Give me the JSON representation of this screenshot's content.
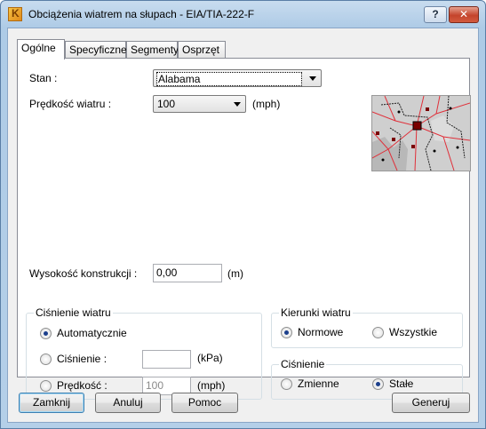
{
  "window": {
    "title": "Obciążenia wiatrem na słupach - EIA/TIA-222-F",
    "help_label": "?",
    "close_label": "✕"
  },
  "tabs": [
    {
      "label": "Ogólne",
      "active": true
    },
    {
      "label": "Specyficzne",
      "active": false
    },
    {
      "label": "Segmenty",
      "active": false
    },
    {
      "label": "Osprzęt",
      "active": false
    }
  ],
  "general": {
    "state_label": "Stan :",
    "state_value": "Alabama",
    "wind_speed_label": "Prędkość wiatru :",
    "wind_speed_value": "100",
    "wind_speed_unit": "(mph)",
    "structure_height_label": "Wysokość konstrukcji :",
    "structure_height_value": "0,00",
    "structure_height_unit": "(m)"
  },
  "wind_pressure": {
    "title": "Ciśnienie wiatru",
    "automatic_label": "Automatycznie",
    "pressure_label": "Ciśnienie :",
    "pressure_value": "",
    "pressure_unit": "(kPa)",
    "speed_label": "Prędkość :",
    "speed_value": "100",
    "speed_unit": "(mph)",
    "selected": "automatic"
  },
  "wind_directions": {
    "title": "Kierunki wiatru",
    "normal_label": "Normowe",
    "all_label": "Wszystkie",
    "selected": "normal"
  },
  "pressure_mode": {
    "title": "Ciśnienie",
    "variable_label": "Zmienne",
    "constant_label": "Stałe",
    "selected": "constant"
  },
  "buttons": {
    "close": "Zamknij",
    "cancel": "Anuluj",
    "help": "Pomoc",
    "generate": "Generuj"
  },
  "colors": {
    "map_road": "#e0303a",
    "map_fill": "#cfcfcf"
  }
}
